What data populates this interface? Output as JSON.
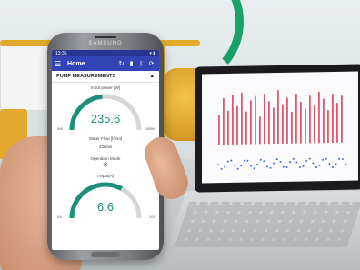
{
  "phone": {
    "brand": "SAMSUNG",
    "status_time": "13:35",
    "appbar": {
      "menu_icon": "menu-icon",
      "title": "Home",
      "icons": [
        "refresh-icon",
        "signal-icon",
        "bluetooth-icon",
        "sync-icon"
      ]
    },
    "section_title": "PUMP MEASUREMENTS",
    "power": {
      "label": "Input power [W]",
      "value": "235.6",
      "min": "0W",
      "max": "500W",
      "fraction": 0.47
    },
    "flow": {
      "label": "Water Flow [l/min]",
      "value": "43l/min"
    },
    "mode": {
      "label": "Operation Mode",
      "icon": "sun-icon"
    },
    "current": {
      "label": "I input[A]",
      "value": "6.6",
      "min": "0A",
      "max": "10A",
      "fraction": 0.66
    }
  },
  "laptop": {
    "chart_bars": [
      0.55,
      0.85,
      0.62,
      0.9,
      0.7,
      0.95,
      0.6,
      0.8,
      0.88,
      0.5,
      0.92,
      0.78,
      0.66,
      0.98,
      0.72,
      0.84,
      0.58,
      0.91,
      0.76,
      0.63,
      0.87,
      0.69,
      0.94,
      0.81,
      0.6,
      0.9,
      0.73,
      0.86
    ],
    "colors": {
      "bar": "#e0566a",
      "accent": "#3f6fd1"
    }
  },
  "colors": {
    "appbar": "#3344b5",
    "statusbar": "#283593",
    "gauge": "#1b8f7a"
  }
}
